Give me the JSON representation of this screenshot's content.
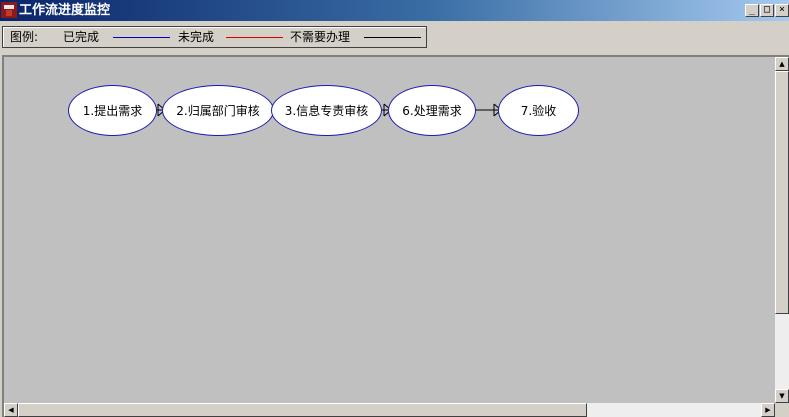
{
  "window": {
    "title": "工作流进度监控",
    "buttons": {
      "minimize": "_",
      "maximize": "□",
      "close": "×"
    }
  },
  "legend": {
    "label": "图例:",
    "items": [
      {
        "label": "已完成",
        "color": "#0000cc"
      },
      {
        "label": "未完成",
        "color": "#dd0000"
      },
      {
        "label": "不需要办理",
        "color": "#000000"
      }
    ]
  },
  "workflow": {
    "nodes": [
      {
        "label": "1.提出需求"
      },
      {
        "label": "2.归属部门审核"
      },
      {
        "label": "3.信息专责审核"
      },
      {
        "label": "6.处理需求"
      },
      {
        "label": "7.验收"
      }
    ],
    "node_border_color": "#1a1ab0",
    "connector_color": "#000000"
  },
  "scrollbars": {
    "up_arrow": "▲",
    "down_arrow": "▼",
    "left_arrow": "◀",
    "right_arrow": "▶"
  }
}
